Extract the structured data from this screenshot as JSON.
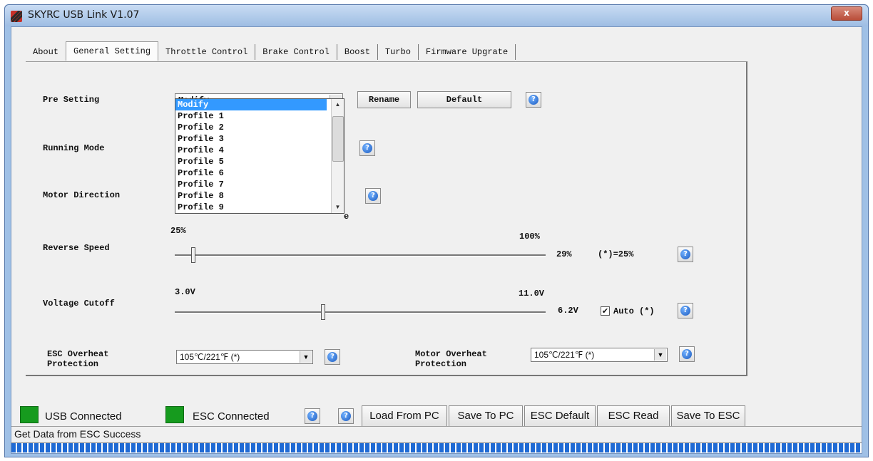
{
  "window": {
    "title": "SKYRC USB Link V1.07",
    "close": "x"
  },
  "tabs": [
    "About",
    "General Setting",
    "Throttle Control",
    "Brake Control",
    "Boost",
    "Turbo",
    "Firmware Upgrate"
  ],
  "active_tab": "General Setting",
  "pre_setting": {
    "label": "Pre Setting",
    "value": "Modify",
    "rename": "Rename",
    "default": "Default",
    "options": [
      "Modify",
      "Profile 1",
      "Profile 2",
      "Profile 3",
      "Profile 4",
      "Profile 5",
      "Profile 6",
      "Profile 7",
      "Profile 8",
      "Profile 9"
    ],
    "hidden_suffix": "e"
  },
  "running_mode": {
    "label": "Running Mode"
  },
  "motor_direction": {
    "label": "Motor Direction"
  },
  "reverse_speed": {
    "label": "Reverse Speed",
    "min": "25%",
    "max": "100%",
    "value": "29%",
    "default_note": "(*)=25%",
    "fraction": 0.05
  },
  "voltage_cutoff": {
    "label": "Voltage Cutoff",
    "min": "3.0V",
    "max": "11.0V",
    "value": "6.2V",
    "auto_checked": true,
    "auto_label": "Auto (*)",
    "fraction": 0.4
  },
  "esc_overheat": {
    "label_line1": "ESC Overheat",
    "label_line2": "Protection",
    "value": "105℃/221℉ (*)"
  },
  "motor_overheat": {
    "label_line1": "Motor Overheat",
    "label_line2": "Protection",
    "value": "105℃/221℉ (*)"
  },
  "help_glyph": "?",
  "status": {
    "usb": "USB Connected",
    "esc": "ESC Connected",
    "message": "Get Data from ESC Success"
  },
  "buttons": {
    "load_from_pc": "Load From PC",
    "save_to_pc": "Save To PC",
    "esc_default": "ESC Default",
    "esc_read": "ESC Read",
    "save_to_esc": "Save To ESC"
  },
  "colors": {
    "selection": "#3399ff",
    "status_green": "#169b1e",
    "progress": "#1f6ad4"
  }
}
